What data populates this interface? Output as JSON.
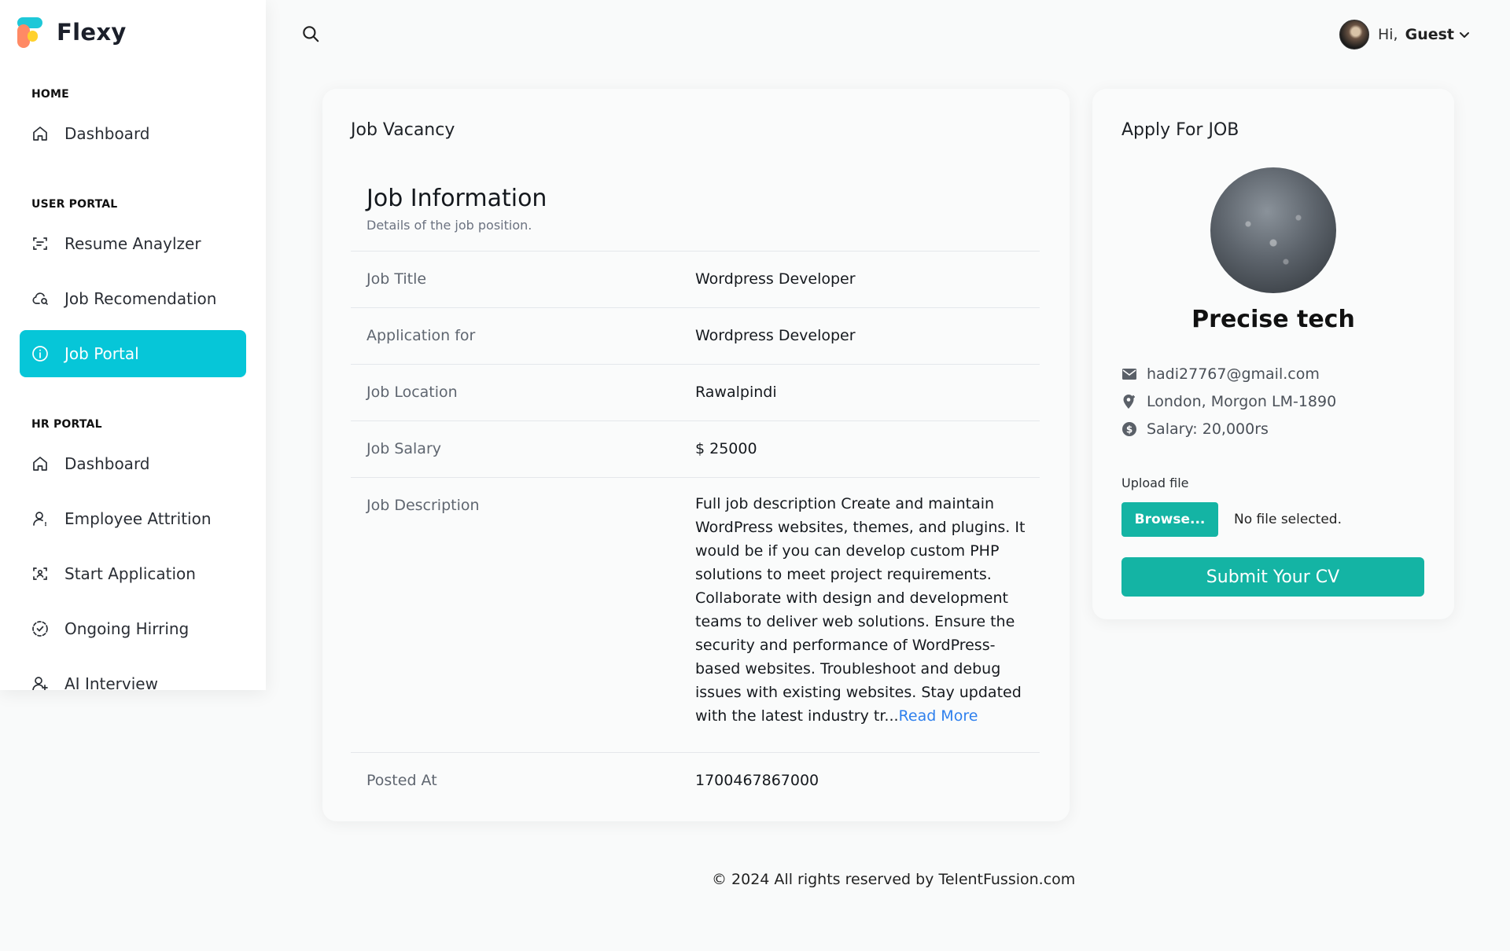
{
  "app": {
    "name": "Flexy"
  },
  "sidebar": {
    "sections": [
      {
        "title": "HOME"
      },
      {
        "title": "USER PORTAL"
      },
      {
        "title": "HR PORTAL"
      }
    ],
    "items": [
      {
        "label": "Dashboard",
        "icon": "home-icon"
      },
      {
        "label": "Resume Anaylzer",
        "icon": "scan-text-icon"
      },
      {
        "label": "Job Recomendation",
        "icon": "cloud-search-icon"
      },
      {
        "label": "Job Portal",
        "icon": "info-circle-icon",
        "active": true
      },
      {
        "label": "Dashboard",
        "icon": "home-icon"
      },
      {
        "label": "Employee Attrition",
        "icon": "user-icon"
      },
      {
        "label": "Start Application",
        "icon": "scan-face-icon"
      },
      {
        "label": "Ongoing Hirring",
        "icon": "check-circle-dashed-icon"
      },
      {
        "label": "AI Interview",
        "icon": "users-icon"
      }
    ]
  },
  "header": {
    "search_icon": "search-icon",
    "greeting": "Hi,",
    "user_name": "Guest"
  },
  "job_card": {
    "title": "Job Vacancy",
    "info_title": "Job Information",
    "info_subtitle": "Details of the job position.",
    "rows": [
      {
        "label": "Job Title",
        "value": "Wordpress Developer"
      },
      {
        "label": "Application for",
        "value": "Wordpress Developer"
      },
      {
        "label": "Job Location",
        "value": "Rawalpindi"
      },
      {
        "label": "Job Salary",
        "value": "$ 25000"
      },
      {
        "label": "Job Description",
        "value": "Full job description Create and maintain WordPress websites, themes, and plugins. It would be if you can develop custom PHP solutions to meet project requirements. Collaborate with design and development teams to deliver web solutions. Ensure the security and performance of WordPress-based websites. Troubleshoot and debug issues with existing websites. Stay updated with the latest industry tr...",
        "link": "Read More"
      },
      {
        "label": "Posted At",
        "value": "1700467867000"
      }
    ]
  },
  "apply_card": {
    "title": "Apply For JOB",
    "company": "Precise tech",
    "email": "hadi27767@gmail.com",
    "location": "London, Morgon LM-1890",
    "salary": "Salary: 20,000rs",
    "upload_label": "Upload file",
    "browse_label": "Browse...",
    "no_file": "No file selected.",
    "submit_label": "Submit Your CV"
  },
  "footer": {
    "text": "© 2024 All rights reserved by TelentFussion.com"
  },
  "colors": {
    "accent": "#06c6d8",
    "primary_button": "#14b4a4",
    "link": "#2f80ed"
  }
}
